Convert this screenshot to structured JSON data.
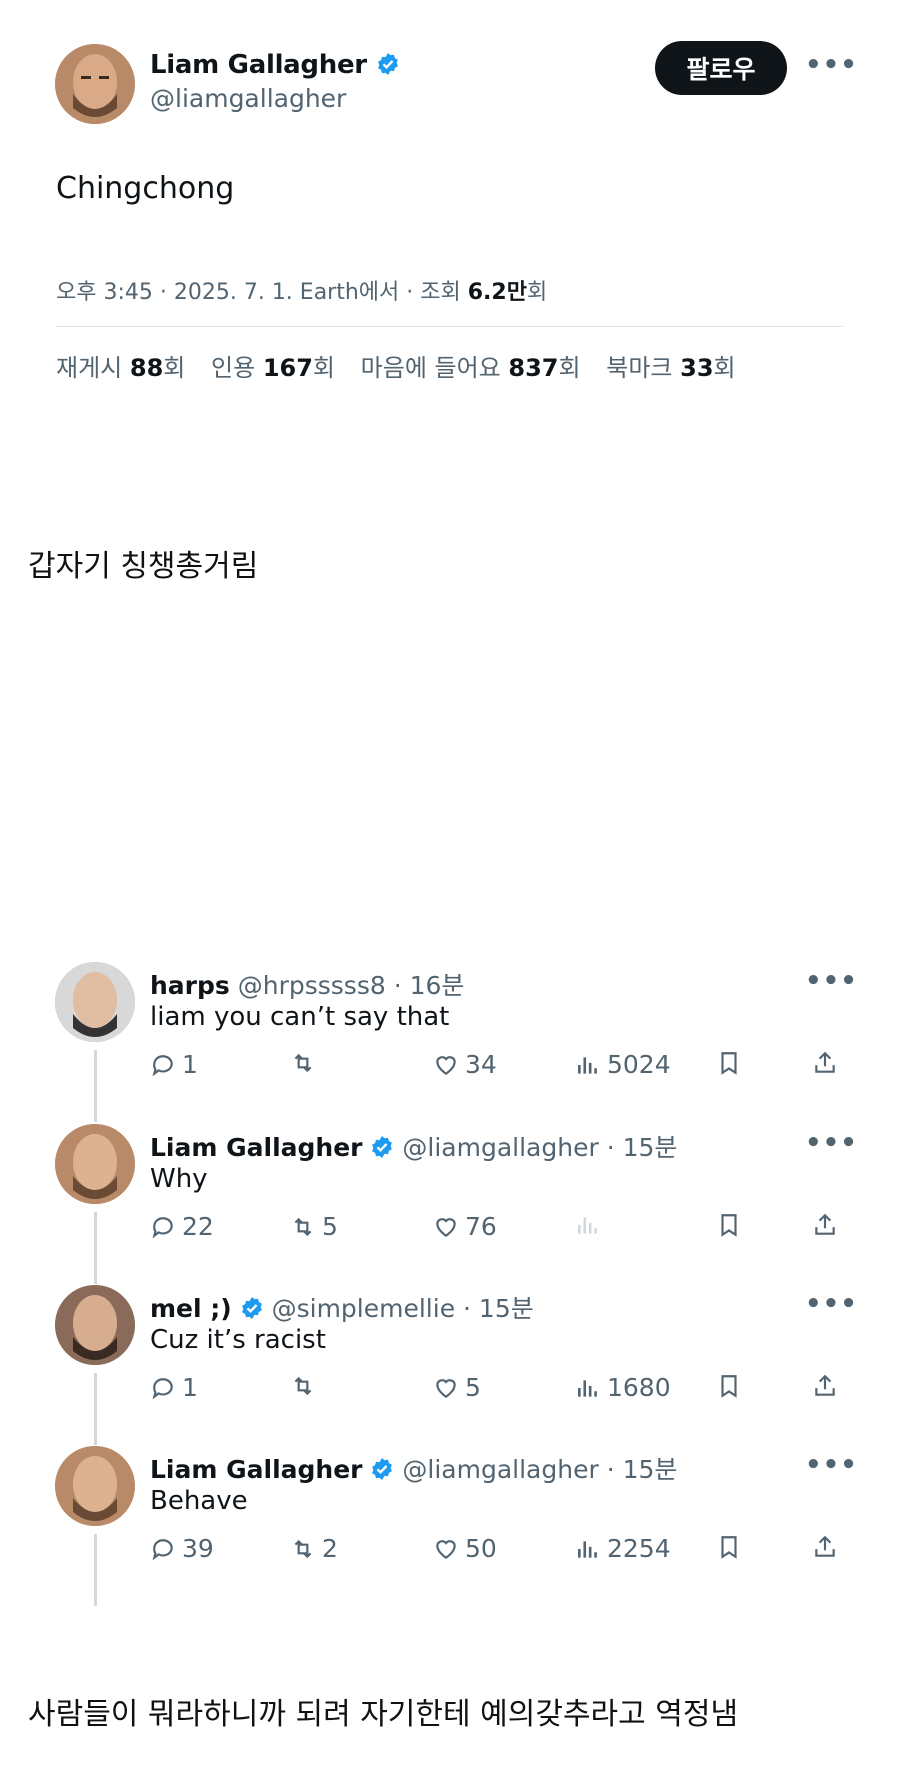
{
  "main_tweet": {
    "name": "Liam Gallagher",
    "handle": "@liamgallagher",
    "follow_label": "팔로우",
    "text": "Chingchong",
    "meta_prefix": "오후 3:45 · 2025. 7. 1. Earth에서 · 조회 ",
    "views": "6.2만",
    "views_suffix": "회",
    "stats": [
      {
        "label": "재게시 ",
        "value": "88",
        "suffix": "회"
      },
      {
        "label": "인용 ",
        "value": "167",
        "suffix": "회"
      },
      {
        "label": "마음에 들어요 ",
        "value": "837",
        "suffix": "회"
      },
      {
        "label": "북마크 ",
        "value": "33",
        "suffix": "회"
      }
    ]
  },
  "caption_1": "갑자기 칭챙총거림",
  "replies": [
    {
      "name": "harps",
      "handle": "@hrpsssss8 · 16분",
      "text": "liam you can’t say that",
      "reply_count": "1",
      "repost_count": "",
      "like_count": "34",
      "view_count": "5024"
    },
    {
      "name": "Liam Gallagher",
      "handle": "@liamgallagher · 15분",
      "text": "Why",
      "reply_count": "22",
      "repost_count": "5",
      "like_count": "76",
      "view_count": ""
    },
    {
      "name": "mel ;)",
      "handle": "@simplemellie · 15분",
      "text": "Cuz it’s racist",
      "reply_count": "1",
      "repost_count": "",
      "like_count": "5",
      "view_count": "1680"
    },
    {
      "name": "Liam Gallagher",
      "handle": "@liamgallagher · 15분",
      "text": "Behave",
      "reply_count": "39",
      "repost_count": "2",
      "like_count": "50",
      "view_count": "2254"
    }
  ],
  "caption_2": "사람들이 뭐라하니까 되려 자기한테 예의갖추라고 역정냄",
  "colors": {
    "verified": "#1d9bf0",
    "text": "#0f1419",
    "muted": "#536471"
  }
}
